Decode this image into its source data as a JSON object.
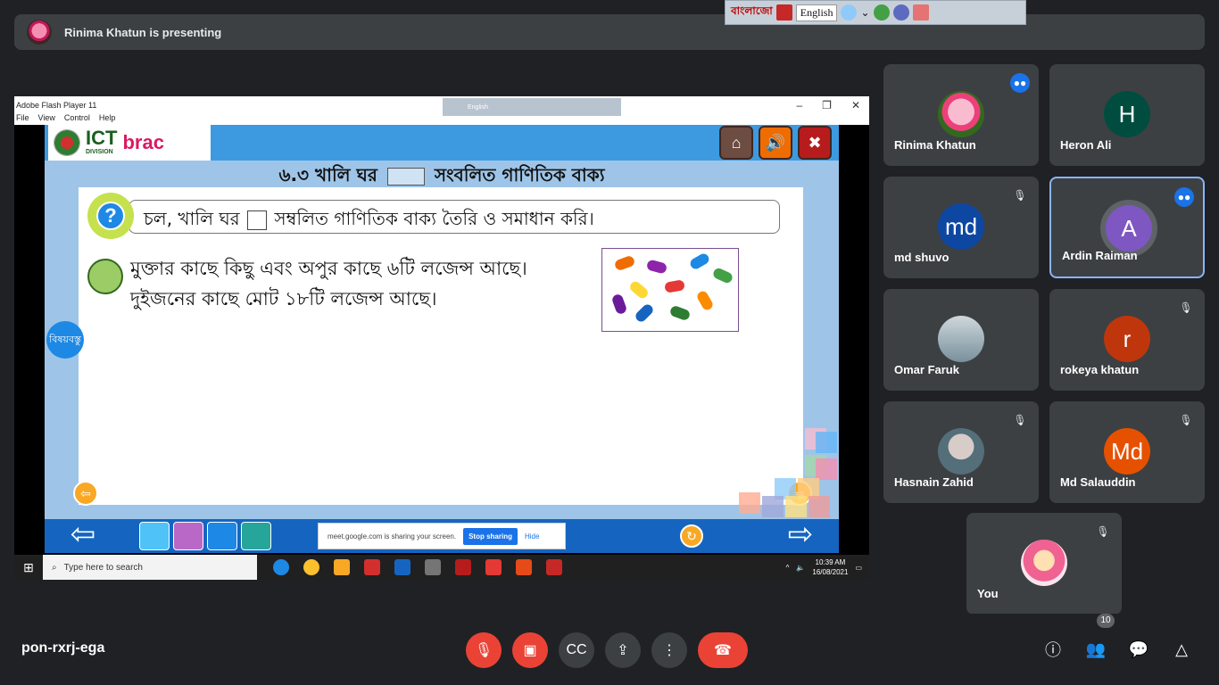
{
  "presenter": {
    "text": "Rinima Khatun is presenting"
  },
  "ime_bar": {
    "bangla_label": "বাংলাজো",
    "language": "English"
  },
  "flash": {
    "title": "Adobe Flash Player 11",
    "menu": [
      "File",
      "View",
      "Control",
      "Help"
    ],
    "mini_lang": "English",
    "logo": {
      "ict": "ICT",
      "division": "DIVISION",
      "brac": "brac"
    },
    "heading_left": "৬.৩  খালি ঘর",
    "heading_right": "সংবলিত গাণিতিক বাক্য",
    "instruction_left": "চল, খালি ঘর",
    "instruction_right": "সম্বলিত গাণিতিক বাক্য তৈরি ও সমাধান করি।",
    "story_line1": "মুক্তার কাছে কিছু এবং অপুর কাছে ৬টি লজেন্স আছে।",
    "story_line2": "দুইজনের কাছে মোট ১৮টি লজেন্স আছে।",
    "topics_button": "বিষয়বস্তু"
  },
  "share_bar": {
    "message": "meet.google.com is sharing your screen.",
    "stop": "Stop sharing",
    "hide": "Hide"
  },
  "taskbar": {
    "search_placeholder": "Type here to search",
    "time": "10:39 AM",
    "date": "16/08/2021"
  },
  "participants": [
    {
      "name": "Rinima Khatun",
      "initial": "",
      "color": "#000000",
      "mic": "talk"
    },
    {
      "name": "Heron Ali",
      "initial": "H",
      "color": "#004d40",
      "mic": "none"
    },
    {
      "name": "md shuvo",
      "initial": "md",
      "color": "#0d47a1",
      "mic": "muted"
    },
    {
      "name": "Ardin Raiman",
      "initial": "A",
      "color": "#7e57c2",
      "mic": "talk"
    },
    {
      "name": "Omar Faruk",
      "initial": "",
      "color": "#9e9e9e",
      "mic": "none"
    },
    {
      "name": "rokeya khatun",
      "initial": "r",
      "color": "#bf360c",
      "mic": "muted"
    },
    {
      "name": "Hasnain Zahid",
      "initial": "",
      "color": "#607d8b",
      "mic": "muted"
    },
    {
      "name": "Md Salauddin",
      "initial": "Md",
      "color": "#e65100",
      "mic": "muted"
    },
    {
      "name": "You",
      "initial": "",
      "color": "#f8bbd0",
      "mic": "muted"
    }
  ],
  "bottom": {
    "meeting_code": "pon-rxrj-ega",
    "people_count": "10"
  },
  "colors": {
    "accent": "#1a73e8",
    "danger": "#ea4335",
    "tile_bg": "#3c4043"
  }
}
